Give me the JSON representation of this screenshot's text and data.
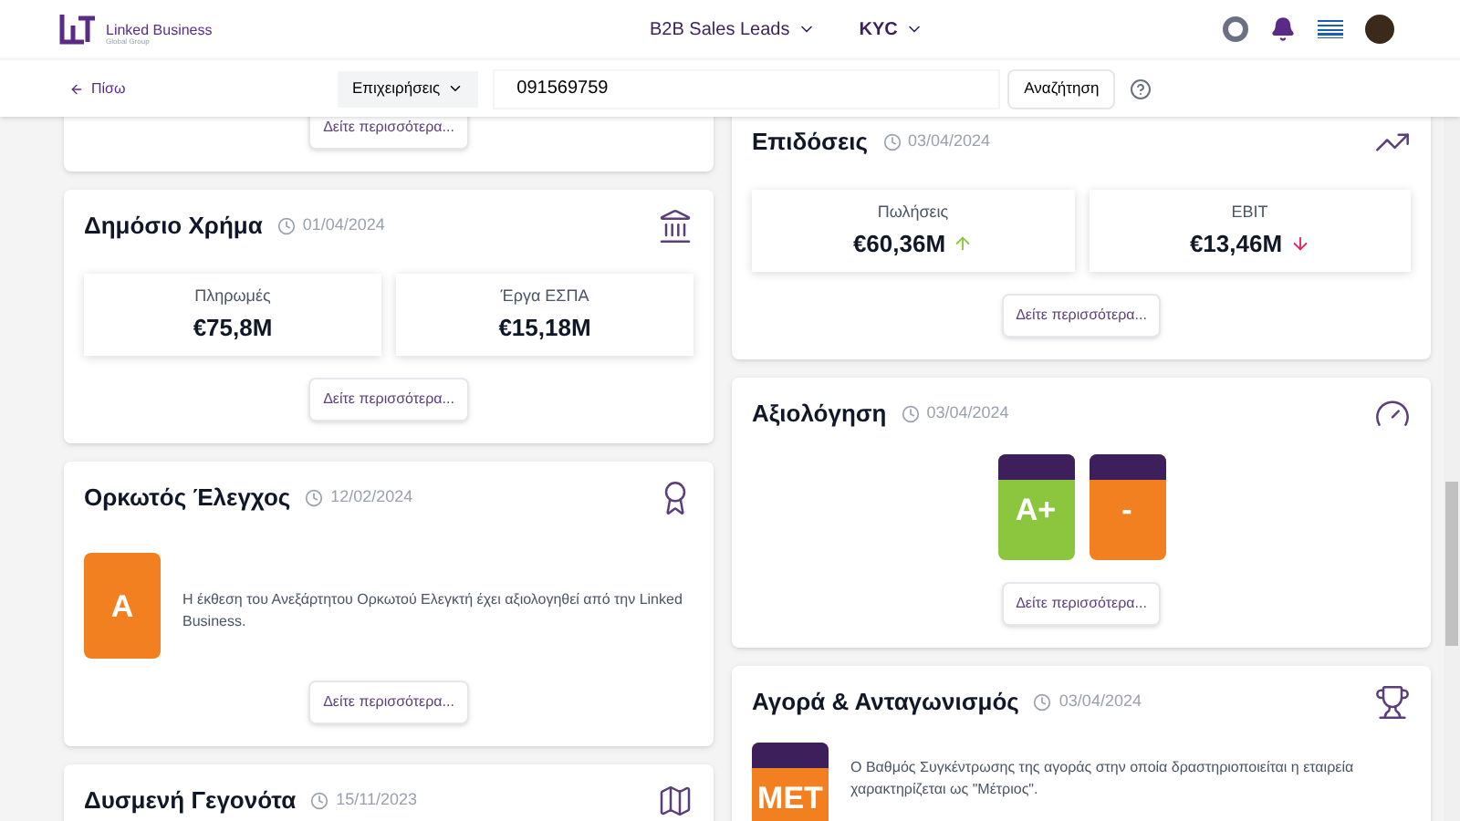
{
  "brand": {
    "name": "Linked Business",
    "tagline": "Global Group"
  },
  "nav": [
    {
      "label": "B2B Sales Leads",
      "selected": false
    },
    {
      "label": "KYC",
      "selected": true
    }
  ],
  "toolbar": {
    "back": "Πίσω",
    "category": "Επιχειρήσεις",
    "search_value": "091569759",
    "search_button": "Αναζήτηση"
  },
  "left_cards": [
    {
      "kind": "more_only",
      "more": "Δείτε περισσότερα..."
    },
    {
      "kind": "metrics",
      "title": "Δημόσιο Χρήμα",
      "date": "01/04/2024",
      "metrics": [
        {
          "label": "Πληρωμές",
          "value": "€75,8M"
        },
        {
          "label": "Έργα ΕΣΠΑ",
          "value": "€15,18M"
        }
      ],
      "more": "Δείτε περισσότερα..."
    },
    {
      "kind": "badge_text",
      "title": "Ορκωτός Έλεγχος",
      "date": "12/02/2024",
      "badge": {
        "grade": "A",
        "color": "#f28020",
        "header": false
      },
      "text": "Η έκθεση του Ανεξάρτητου Ορκωτού Ελεγκτή έχει αξιολογηθεί από την Linked Business.",
      "more": "Δείτε περισσότερα..."
    },
    {
      "kind": "title_only",
      "title": "Δυσμενή Γεγονότα",
      "date": "15/11/2023"
    }
  ],
  "right_cards": [
    {
      "kind": "metrics",
      "title": "Επιδόσεις",
      "date": "03/04/2024",
      "metrics": [
        {
          "label": "Πωλήσεις",
          "value": "€60,36M",
          "rising": true
        },
        {
          "label": "EBIT",
          "value": "€13,46M",
          "rising": false
        }
      ],
      "more": "Δείτε περισσότερα..."
    },
    {
      "kind": "ratings",
      "title": "Αξιολόγηση",
      "date": "03/04/2024",
      "badges": [
        {
          "grade": "A+",
          "color": "#8cc63f",
          "header": true
        },
        {
          "grade": "-",
          "color": "#f28020",
          "header": true
        }
      ],
      "more": "Δείτε περισσότερα..."
    },
    {
      "kind": "badge_text",
      "title": "Αγορά & Ανταγωνισμός",
      "date": "03/04/2024",
      "badge": {
        "grade": "ΜΕΤ",
        "color": "#f28020",
        "header": true
      },
      "text": "Ο Βαθμός Συγκέντρωσης της αγοράς στην οποία δραστηριοποιείται η εταιρεία χαρακτηρίζεται ως \"Μέτριος\"."
    }
  ]
}
